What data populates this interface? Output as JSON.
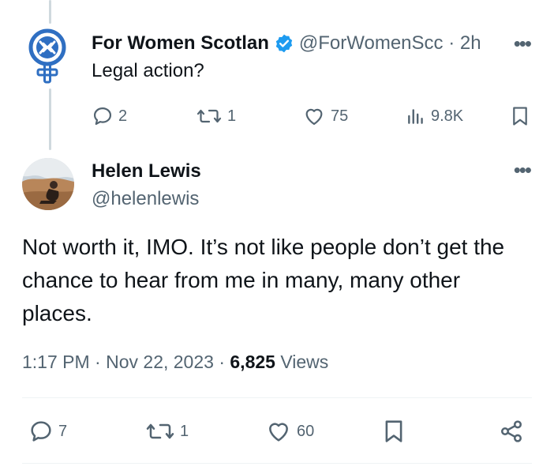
{
  "parent_tweet": {
    "author_name": "For Women Scotlan",
    "handle_time": "@ForWomenScc · 2h",
    "text": "Legal action?",
    "stats": {
      "replies": "2",
      "retweets": "1",
      "likes": "75",
      "views": "9.8K"
    }
  },
  "reply_tweet": {
    "author_name": "Helen Lewis",
    "handle": "@helenlewis",
    "text": "Not worth it, IMO. It’s not like people don’t get the chance to hear from me in many, many other places.",
    "time": "1:17 PM",
    "separator": "·",
    "date": "Nov 22, 2023",
    "views_count": "6,825",
    "views_label": "Views",
    "stats": {
      "replies": "7",
      "retweets": "1",
      "likes": "60"
    }
  },
  "colors": {
    "verified_blue": "#1d9bf0",
    "muted_text": "#536471",
    "brand_blue": "#2f6fc2"
  }
}
